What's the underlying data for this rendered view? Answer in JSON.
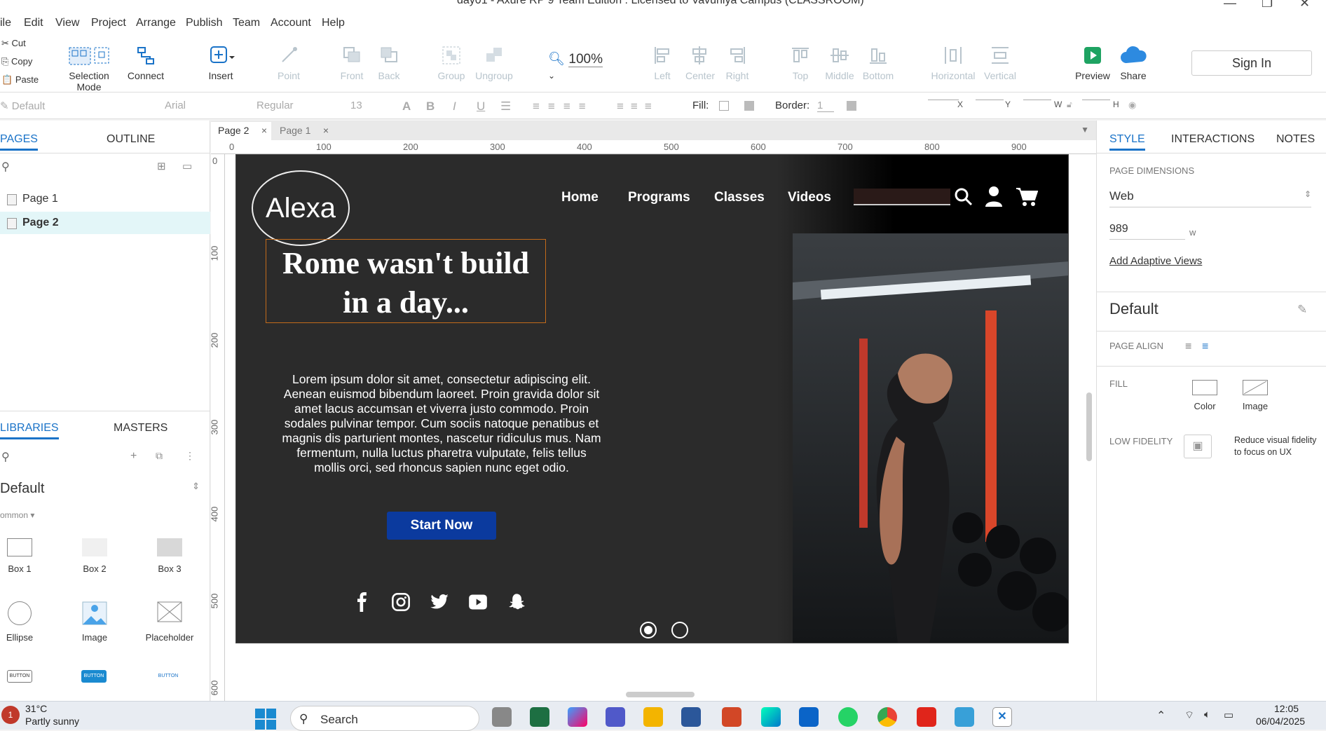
{
  "window": {
    "title": "day01 - Axure RP 9 Team Edition : Licensed to Vavuniya Campus (CLASSROOM)"
  },
  "menu": [
    "ile",
    "Edit",
    "View",
    "Project",
    "Arrange",
    "Publish",
    "Team",
    "Account",
    "Help"
  ],
  "clipboard": {
    "cut": "Cut",
    "copy": "Copy",
    "paste": "Paste"
  },
  "toolbar": {
    "selection_mode": "Selection Mode",
    "connect": "Connect",
    "insert": "Insert",
    "point": "Point",
    "front": "Front",
    "back": "Back",
    "group": "Group",
    "ungroup": "Ungroup",
    "zoom": "100%",
    "left": "Left",
    "center": "Center",
    "right": "Right",
    "top": "Top",
    "middle": "Middle",
    "bottom": "Bottom",
    "horizontal": "Horizontal",
    "vertical": "Vertical",
    "preview": "Preview",
    "share": "Share",
    "sign_in": "Sign In"
  },
  "format": {
    "style": "Default",
    "font": "Arial",
    "weight": "Regular",
    "size": "13",
    "fill": "Fill:",
    "border": "Border:",
    "border_val": "1",
    "x": "X",
    "y": "Y",
    "w": "W",
    "h": "H"
  },
  "left_panel": {
    "tabs": {
      "pages": "PAGES",
      "outline": "OUTLINE"
    },
    "pages": [
      "Page 1",
      "Page 2"
    ],
    "lib_tabs": {
      "libraries": "LIBRARIES",
      "masters": "MASTERS"
    },
    "library": "Default",
    "section": "ommon",
    "items": [
      {
        "label": "Box 1"
      },
      {
        "label": "Box 2"
      },
      {
        "label": "Box 3"
      },
      {
        "label": "Ellipse"
      },
      {
        "label": "Image"
      },
      {
        "label": "Placeholder"
      }
    ]
  },
  "tabs": [
    "Page 2",
    "Page 1"
  ],
  "ruler": {
    "top": [
      "0",
      "100",
      "200",
      "300",
      "400",
      "500",
      "600",
      "700",
      "800",
      "900"
    ],
    "left": [
      "0",
      "100",
      "200",
      "300",
      "400",
      "500",
      "600"
    ]
  },
  "design": {
    "logo": "Alexa",
    "nav": [
      "Home",
      "Programs",
      "Classes",
      "Videos"
    ],
    "headline": "Rome wasn't build in a day...",
    "body": "Lorem ipsum dolor sit amet, consectetur adipiscing elit. Aenean euismod bibendum laoreet. Proin gravida dolor sit amet lacus accumsan et viverra justo commodo. Proin sodales pulvinar tempor. Cum sociis natoque penatibus et magnis dis parturient montes, nascetur ridiculus mus. Nam fermentum, nulla luctus pharetra vulputate, felis tellus mollis orci, sed rhoncus sapien nunc eget odio.",
    "cta": "Start Now",
    "colors": {
      "bg": "#2b2b2b",
      "cta": "#0b3a9e",
      "frame": "#c26a1a"
    }
  },
  "right_panel": {
    "tabs": {
      "style": "STYLE",
      "interactions": "INTERACTIONS",
      "notes": "NOTES"
    },
    "page_dimensions": "PAGE DIMENSIONS",
    "dim_value": "Web",
    "width": "989",
    "width_unit": "w",
    "adaptive": "Add Adaptive Views",
    "default": "Default",
    "page_align": "PAGE ALIGN",
    "fill": "FILL",
    "fill_color": "Color",
    "fill_image": "Image",
    "low_fidelity": "LOW FIDELITY",
    "low_fidelity_text": "Reduce visual fidelity to focus on UX"
  },
  "taskbar": {
    "temp": "31°C",
    "weather": "Partly sunny",
    "search": "Search",
    "time": "12:05",
    "date": "06/04/2025",
    "badge": "1"
  }
}
